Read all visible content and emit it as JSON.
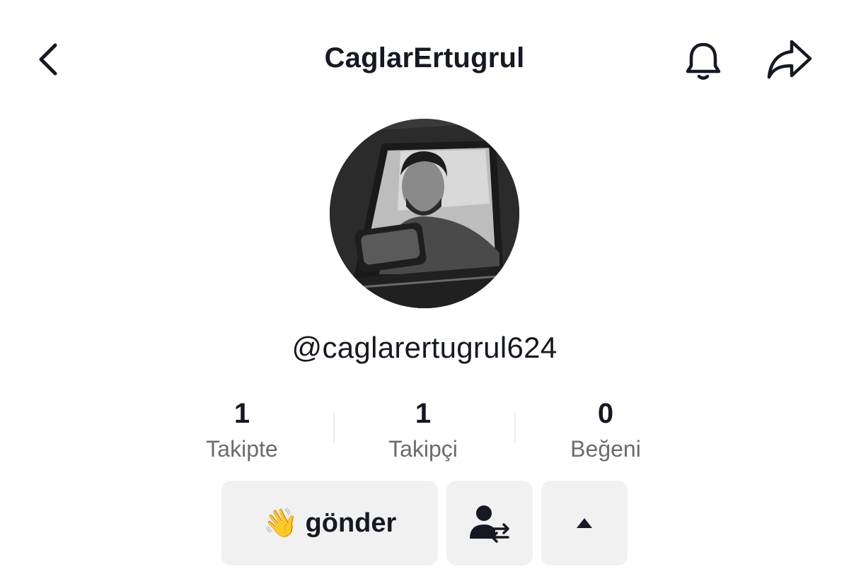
{
  "header": {
    "title": "CaglarErtugrul",
    "icons": [
      "chevron-left-icon",
      "bell-icon",
      "share-arrow-icon"
    ]
  },
  "profile": {
    "username": "@caglarertugrul624"
  },
  "stats": [
    {
      "value": "1",
      "label": "Takipte"
    },
    {
      "value": "1",
      "label": "Takipçi"
    },
    {
      "value": "0",
      "label": "Beğeni"
    }
  ],
  "actions": {
    "wave_emoji": "👋",
    "wave_label": "gönder",
    "friend_icon": "user-swap-icon",
    "more_icon": "caret-up-icon"
  },
  "colors": {
    "text": "#161823",
    "secondary_text": "#6a6b72",
    "button_bg": "#f1f1f2",
    "wave_emoji": "#f5c24a"
  }
}
